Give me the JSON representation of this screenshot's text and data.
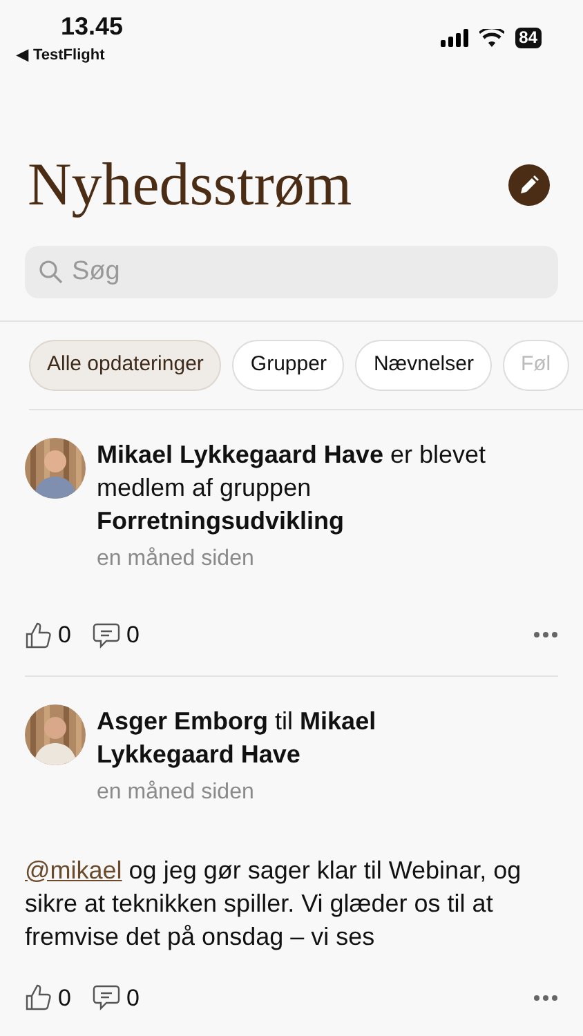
{
  "status_bar": {
    "time": "13.45",
    "back_arrow": "◀",
    "back_label": "TestFlight",
    "battery": "84"
  },
  "title": "Nyhedsstrøm",
  "search": {
    "placeholder": "Søg"
  },
  "filters": [
    {
      "label": "Alle opdateringer",
      "selected": true
    },
    {
      "label": "Grupper",
      "selected": false
    },
    {
      "label": "Nævnelser",
      "selected": false
    },
    {
      "label": "Føl",
      "selected": false
    }
  ],
  "posts": [
    {
      "headline": "**Mikael Lykkegaard Have** er blevet medlem af gruppen **Forretningsudvikling**",
      "time": "en måned siden",
      "likes": "0",
      "comments": "0"
    },
    {
      "headline": "**Asger Emborg** til **Mikael Lykkegaard Have**",
      "time": "en måned siden",
      "mention": "@mikael",
      "body": " og jeg gør sager klar til Webinar, og sikre at teknikken spiller. Vi glæder os til at fremvise det på onsdag – vi ses",
      "likes": "0",
      "comments": "0"
    }
  ]
}
